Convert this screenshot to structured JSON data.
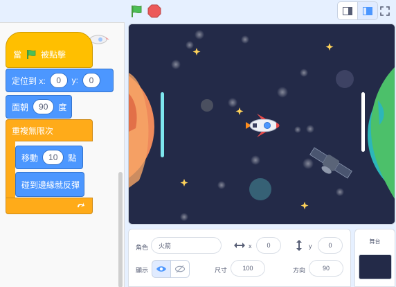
{
  "toolbar": {
    "green_flag_icon": "green-flag-icon",
    "stop_icon": "stop-icon",
    "colors": {
      "flag": "#4cbf56",
      "stop": "#ec5959",
      "background": "#e6f0ff"
    }
  },
  "script": {
    "when_flag": {
      "prefix": "當",
      "suffix": "被點擊"
    },
    "go_to": {
      "label": "定位到 x:",
      "x": "0",
      "y_label": "y:",
      "y": "0"
    },
    "point": {
      "label": "面朝",
      "value": "90",
      "unit": "度"
    },
    "forever": {
      "label": "重複無限次"
    },
    "move": {
      "label": "移動",
      "value": "10",
      "unit": "點"
    },
    "bounce": {
      "label": "碰到邊緣就反彈"
    },
    "colors": {
      "events": "#ffbf00",
      "motion": "#4c97ff",
      "control": "#ffab19"
    }
  },
  "sprite_info": {
    "sprite_label": "角色",
    "sprite_name": "火箭",
    "x_label": "x",
    "x_value": "0",
    "y_label": "y",
    "y_value": "0",
    "show_label": "顯示",
    "size_label": "尺寸",
    "size_value": "100",
    "direction_label": "方向",
    "direction_value": "90"
  },
  "stage_panel": {
    "title": "舞台"
  }
}
